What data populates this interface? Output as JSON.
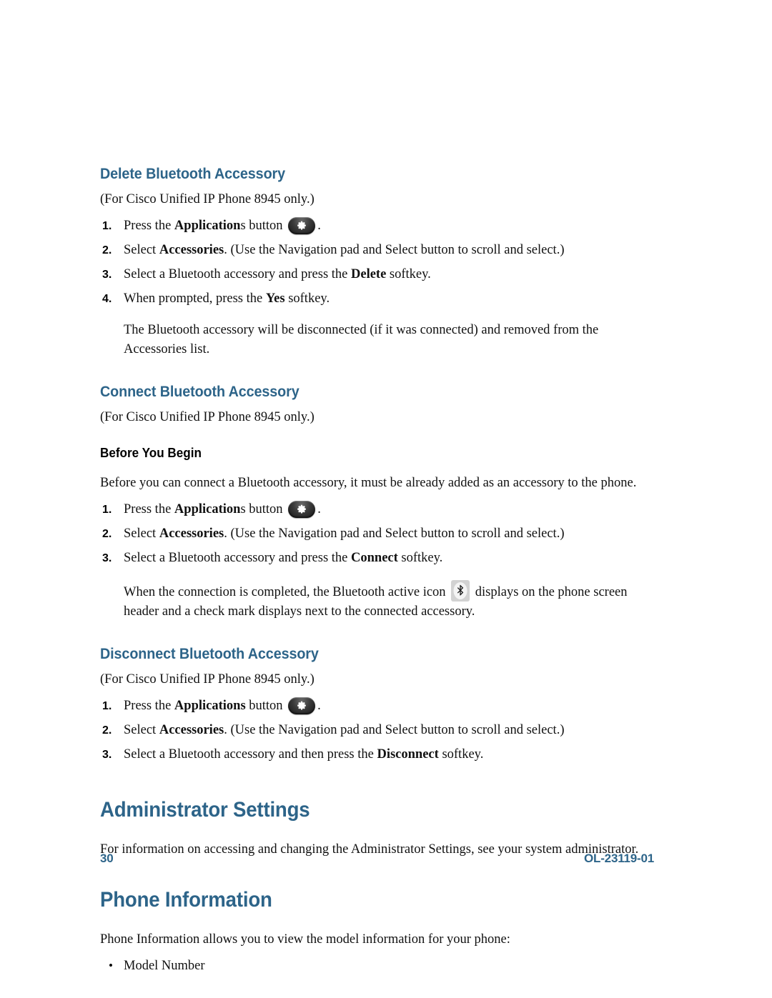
{
  "document": {
    "page_number": "30",
    "doc_id": "OL-23119-01"
  },
  "sections": [
    {
      "heading": "Delete Bluetooth Accessory",
      "note": "(For Cisco Unified IP Phone 8945 only.)",
      "steps": [
        {
          "num": "1.",
          "pre": "Press the ",
          "bold": "Application",
          "post": "s button ",
          "icon": "applications-button-icon",
          "tail": "."
        },
        {
          "num": "2.",
          "pre": "Select ",
          "bold": "Accessories",
          "post": ". (Use the Navigation pad and Select button to scroll and select.)"
        },
        {
          "num": "3.",
          "pre": "Select a Bluetooth accessory and press the ",
          "bold": "Delete",
          "post": " softkey."
        },
        {
          "num": "4.",
          "pre": "When prompted, press the ",
          "bold": "Yes",
          "post": " softkey."
        }
      ],
      "result": "The Bluetooth accessory will be disconnected (if it was connected) and removed from the Accessories list."
    },
    {
      "heading": "Connect Bluetooth Accessory",
      "note": "(For Cisco Unified IP Phone 8945 only.)",
      "subheading": "Before You Begin",
      "intro": "Before you can connect a Bluetooth accessory, it must be already added as an accessory to the phone.",
      "steps": [
        {
          "num": "1.",
          "pre": "Press the ",
          "bold": "Application",
          "post": "s button ",
          "icon": "applications-button-icon",
          "tail": "."
        },
        {
          "num": "2.",
          "pre": "Select ",
          "bold": "Accessories",
          "post": ". (Use the Navigation pad and Select button to scroll and select.)"
        },
        {
          "num": "3.",
          "pre": "Select a Bluetooth accessory and press the ",
          "bold": "Connect",
          "post": " softkey."
        }
      ],
      "result_pre": "When the connection is completed, the Bluetooth active icon ",
      "result_icon": "bluetooth-active-icon",
      "result_post": " displays on the phone screen header and a check mark displays next to the connected accessory."
    },
    {
      "heading": "Disconnect Bluetooth Accessory",
      "note": "(For Cisco Unified IP Phone 8945 only.)",
      "steps": [
        {
          "num": "1.",
          "pre": "Press the ",
          "bold": "Applications",
          "post": " button ",
          "icon": "applications-button-icon",
          "tail": "."
        },
        {
          "num": "2.",
          "pre": "Select ",
          "bold": "Accessories",
          "post": ". (Use the Navigation pad and Select button to scroll and select.)"
        },
        {
          "num": "3.",
          "pre": "Select a Bluetooth accessory and then press the ",
          "bold": "Disconnect",
          "post": " softkey."
        }
      ]
    }
  ],
  "chapters": [
    {
      "heading": "Administrator Settings",
      "body": "For information on accessing and changing the Administrator Settings, see your system administrator."
    },
    {
      "heading": "Phone Information",
      "body": "Phone Information allows you to view the model information for your phone:",
      "bullets": [
        "Model Number"
      ]
    }
  ],
  "colors": {
    "heading_blue": "#2d6489",
    "body_black": "#111111"
  }
}
